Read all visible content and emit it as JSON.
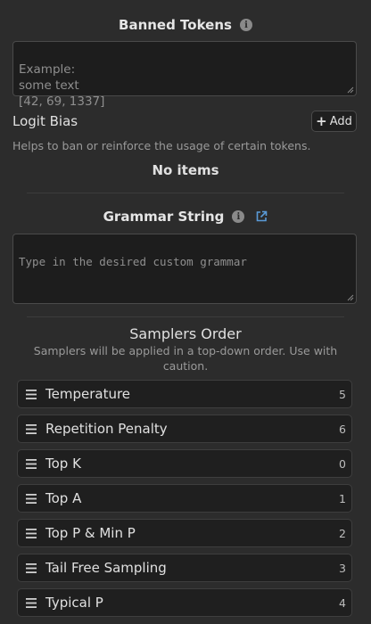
{
  "banned_tokens": {
    "title": "Banned Tokens",
    "placeholder": "Example:\nsome text\n[42, 69, 1337]"
  },
  "logit_bias": {
    "label": "Logit Bias",
    "add_label": "Add",
    "help": "Helps to ban or reinforce the usage of certain tokens.",
    "empty_text": "No items"
  },
  "grammar": {
    "title": "Grammar String",
    "placeholder": "Type in the desired custom grammar"
  },
  "samplers": {
    "title": "Samplers Order",
    "description": "Samplers will be applied in a top-down order. Use with caution.",
    "items": [
      {
        "name": "Temperature",
        "order": "5"
      },
      {
        "name": "Repetition Penalty",
        "order": "6"
      },
      {
        "name": "Top K",
        "order": "0"
      },
      {
        "name": "Top A",
        "order": "1"
      },
      {
        "name": "Top P & Min P",
        "order": "2"
      },
      {
        "name": "Tail Free Sampling",
        "order": "3"
      },
      {
        "name": "Typical P",
        "order": "4"
      }
    ]
  },
  "colors": {
    "background": "#2c2c2c",
    "field_background": "#1d1d1d",
    "text": "#e0e0e0",
    "muted_text": "#9a9a9a"
  },
  "icons": {
    "info": "info-icon",
    "external_link": "external-link-icon",
    "drag_handle": "drag-handle-icon",
    "plus": "plus-icon"
  }
}
